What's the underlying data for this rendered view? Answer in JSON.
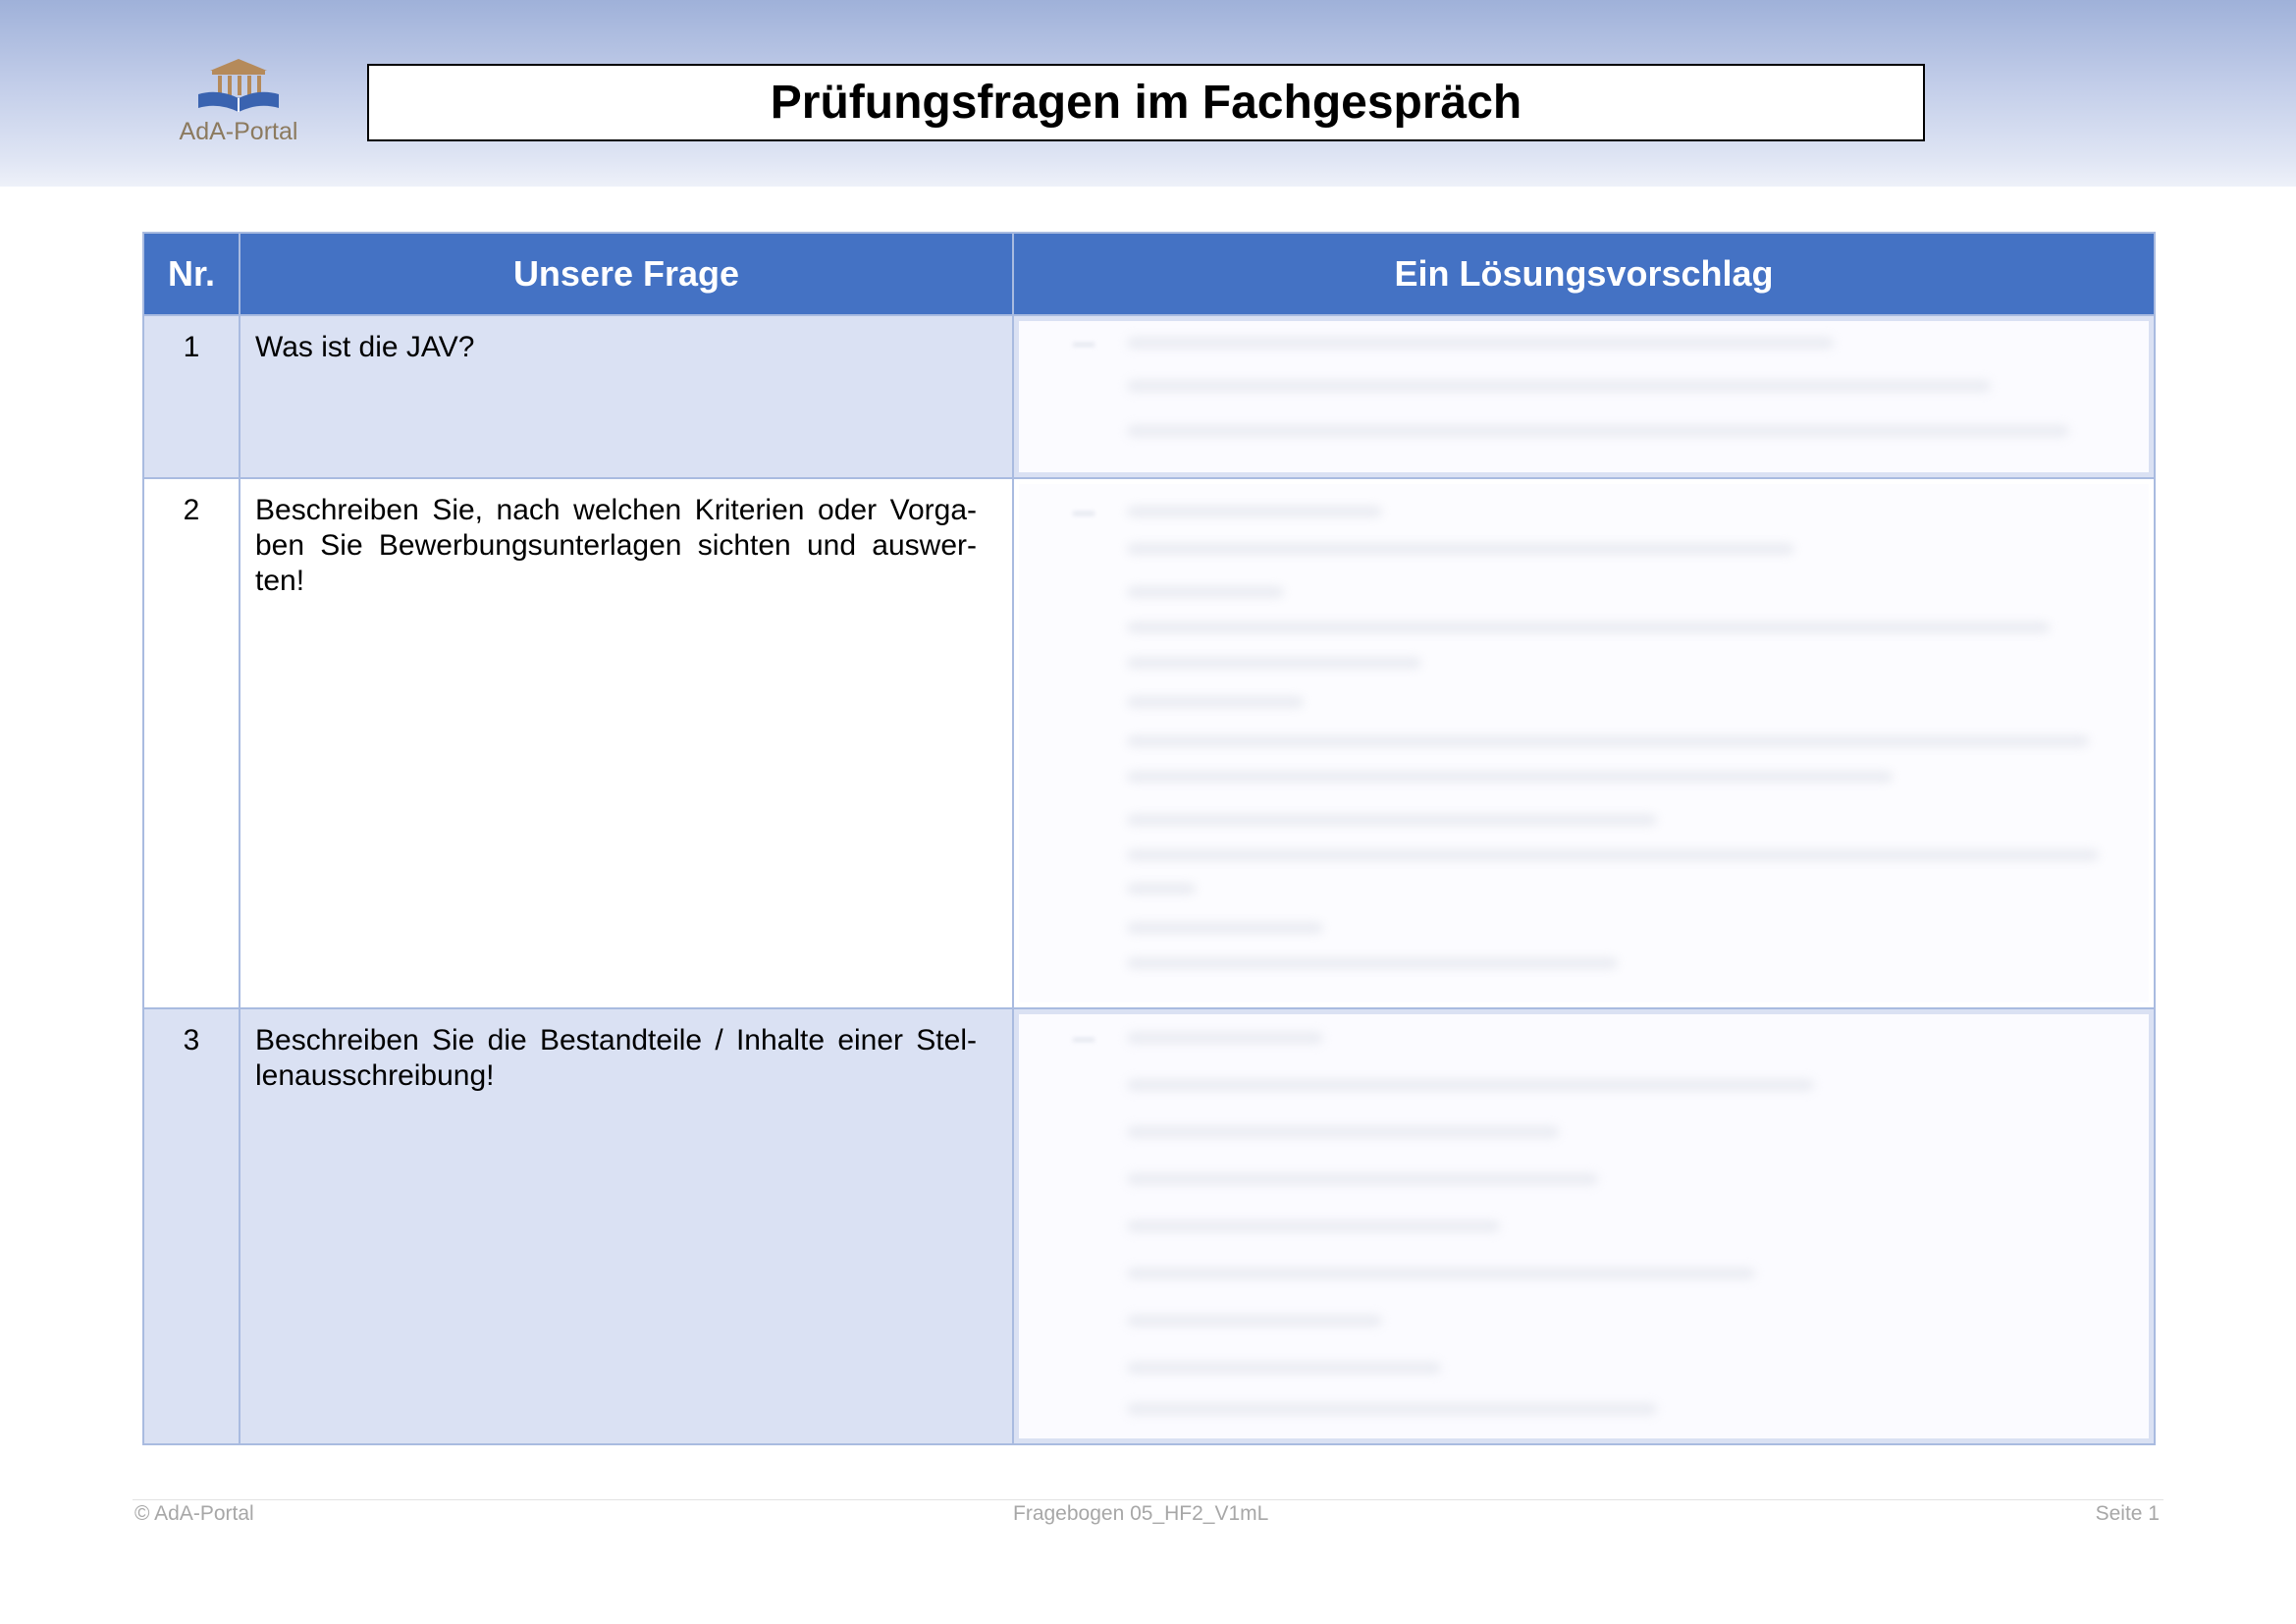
{
  "header": {
    "logo_text": "AdA-Portal",
    "title": "Prüfungsfragen im Fachgespräch"
  },
  "table": {
    "headers": [
      "Nr.",
      "Unsere Frage",
      "Ein Lösungsvorschlag"
    ],
    "rows": [
      {
        "nr": "1",
        "question": "Was ist die JAV?"
      },
      {
        "nr": "2",
        "question": "Beschreiben Sie, nach welchen Kriterien oder Vorga­ben Sie Bewerbungsunterlagen sichten und auswer­ten!"
      },
      {
        "nr": "3",
        "question": "Beschreiben Sie die Bestandteile / Inhalte einer Stel­lenausschreibung!"
      }
    ]
  },
  "footer": {
    "left": "© AdA-Portal",
    "center": "Fragebogen 05_HF2_V1mL",
    "right": "Seite 1"
  },
  "colors": {
    "header_blue": "#4472c4",
    "row_shade": "#dae1f3",
    "border": "#a9bbe0"
  }
}
